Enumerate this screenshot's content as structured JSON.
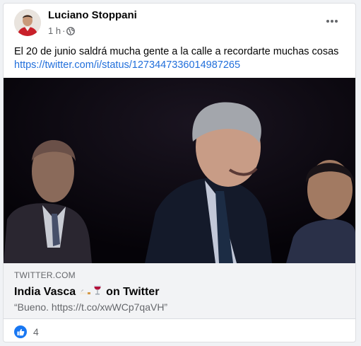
{
  "post": {
    "author": "Luciano Stoppani",
    "time": "1 h",
    "separator": "·",
    "text": "El 20 de junio saldrá mucha gente a la calle a recordarte muchas cosas",
    "url": "https://twitter.com/i/status/1273447336014987265",
    "icons": {
      "avatar": "avatar",
      "privacy": "globe-icon",
      "more": "more-options-icon",
      "reaction": "like-icon"
    }
  },
  "link_preview": {
    "domain": "TWITTER.COM",
    "title_prefix": "India Vasca",
    "title_suffix": "on Twitter",
    "emojis": [
      "cigarette-emoji",
      "wine-glass-emoji"
    ],
    "description": "“Bueno. https://t.co/xwWCp7qaVH”"
  },
  "reactions": {
    "count": "4"
  },
  "colors": {
    "link": "#216fdb",
    "like": "#1877f2",
    "secondary_text": "#65676b"
  }
}
